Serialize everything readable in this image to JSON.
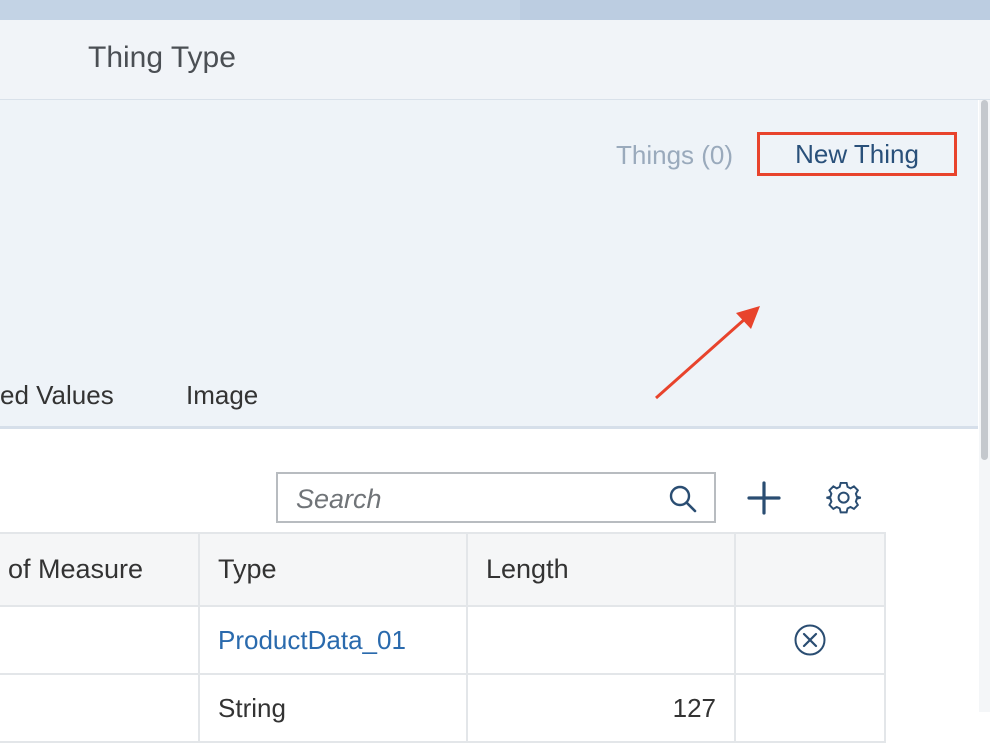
{
  "page": {
    "title": "Thing Type"
  },
  "header": {
    "things_count_label": "Things (0)",
    "new_thing_label": "New Thing"
  },
  "tabs": [
    {
      "label": "ed Values"
    },
    {
      "label": "Image"
    }
  ],
  "toolbar": {
    "search_placeholder": "Search",
    "search_value": ""
  },
  "table": {
    "columns": [
      "of Measure",
      "Type",
      "Length",
      ""
    ],
    "rows": [
      {
        "measure": "",
        "type": "ProductData_01",
        "length": "",
        "action_icon": "remove-circle-icon"
      },
      {
        "measure": "",
        "type": "String",
        "length": "127",
        "action_icon": ""
      }
    ]
  },
  "colors": {
    "accent_highlight": "#e8432c",
    "link": "#2a6aad",
    "header_bg": "#eef3f8"
  }
}
